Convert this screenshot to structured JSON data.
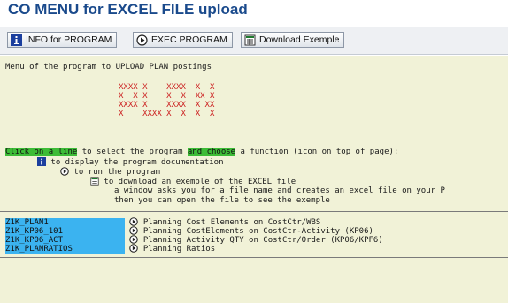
{
  "title": "CO MENU for EXCEL FILE upload",
  "toolbar": {
    "info_label": "INFO for PROGRAM",
    "exec_label": "EXEC PROGRAM",
    "download_label": "Download Exemple"
  },
  "intro": "Menu of the program to UPLOAD PLAN postings",
  "logo_lines": [
    "XXXX X    XXXX  X  X",
    "X  X X    X  X  XX X",
    "XXXX X    XXXX  X XX",
    "X    XXXX X  X  X  X"
  ],
  "instructions": {
    "l1_a": "Click on a line",
    "l1_b": " to select the program ",
    "l1_c": "and choose",
    "l1_d": " a function (icon on top of page):",
    "l2": "to display the program documentation",
    "l3": "to run the program",
    "l4": "to download an exemple of the EXCEL file",
    "l5": "a window asks you for a file name and creates an excel file on your P",
    "l6": "then you can open the file to see the exemple"
  },
  "programs": [
    {
      "name": "Z1K_PLAN1",
      "desc": "Planning Cost Elements on CostCtr/WBS"
    },
    {
      "name": "Z1K_KP06_101",
      "desc": "Planning CostElements on CostCtr-Activity (KP06)"
    },
    {
      "name": "Z1K_KP06_ACT",
      "desc": "Planning Activity QTY on CostCtr/Order (KP06/KPF6)"
    },
    {
      "name": "Z1K_PLANRATIOS",
      "desc": "Planning Ratios"
    }
  ],
  "colors": {
    "title": "#1a4a8c",
    "panel_bg": "#f1f2d7",
    "highlight_green": "#3dbc37",
    "program_blue": "#3bb3f0",
    "logo_red": "#cc2222"
  },
  "icons": [
    "info-icon",
    "execute-icon",
    "download-icon"
  ]
}
